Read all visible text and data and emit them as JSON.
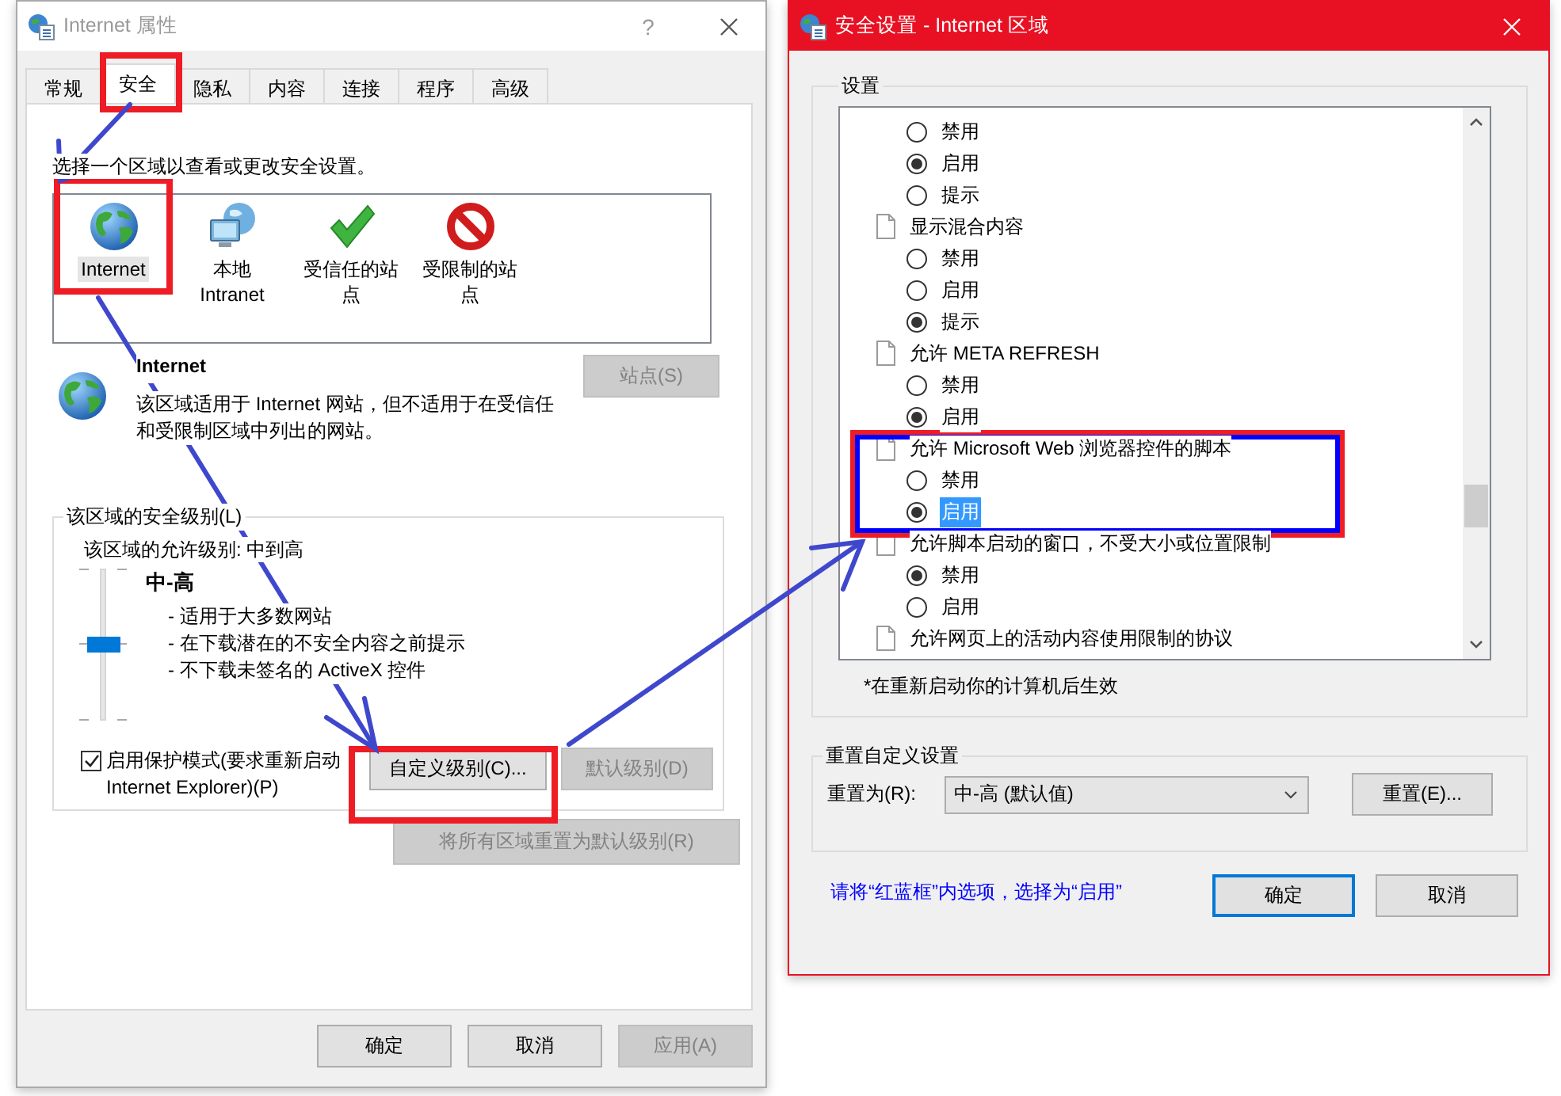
{
  "properties_window": {
    "title": "Internet 属性",
    "active": false,
    "help": "?",
    "tabs": [
      {
        "label": "常规",
        "selected": false
      },
      {
        "label": "安全",
        "selected": true
      },
      {
        "label": "隐私",
        "selected": false
      },
      {
        "label": "内容",
        "selected": false
      },
      {
        "label": "连接",
        "selected": false
      },
      {
        "label": "程序",
        "selected": false
      },
      {
        "label": "高级",
        "selected": false
      }
    ],
    "zone_prompt": "选择一个区域以查看或更改安全设置。",
    "zones": [
      {
        "kind": "globe",
        "label": "Internet",
        "selected": true
      },
      {
        "kind": "intranet",
        "label": "本地 Intranet",
        "selected": false
      },
      {
        "kind": "trusted",
        "label": "受信任的站点",
        "selected": false
      },
      {
        "kind": "restricted",
        "label": "受限制的站点",
        "selected": false
      }
    ],
    "zone_name": "Internet",
    "zone_description": "该区域适用于 Internet 网站，但不适用于在受信任和受限制区域中列出的网站。",
    "sites_button": {
      "label": "站点(S)",
      "disabled": true
    },
    "security_level": {
      "legend": "该区域的安全级别(L)",
      "allowed": "该区域的允许级别: 中到高",
      "level": 0.5,
      "level_name": "中-高",
      "bullets": [
        "- 适用于大多数网站",
        "- 在下载潜在的不安全内容之前提示",
        "- 不下载未签名的 ActiveX 控件"
      ],
      "protected_mode": {
        "label": "启用保护模式(要求重新启动 Internet Explorer)(P)",
        "checked": true
      },
      "custom_button": {
        "label": "自定义级别(C)...",
        "disabled": false
      },
      "default_button": {
        "label": "默认级别(D)",
        "disabled": true
      }
    },
    "reset_all_button": {
      "label": "将所有区域重置为默认级别(R)",
      "disabled": true
    },
    "buttons": [
      {
        "label": "确定",
        "disabled": false
      },
      {
        "label": "取消",
        "disabled": false
      },
      {
        "label": "应用(A)",
        "disabled": true
      }
    ]
  },
  "security_settings_window": {
    "title": "安全设置 - Internet 区域",
    "active": true,
    "settings_legend": "设置",
    "settings": [
      {
        "children": [
          {
            "label": "禁用",
            "selected": false,
            "focused": false
          },
          {
            "label": "启用",
            "selected": true,
            "focused": false
          },
          {
            "label": "提示",
            "selected": false,
            "focused": false
          }
        ]
      },
      {
        "label": "显示混合内容",
        "children": [
          {
            "label": "禁用",
            "selected": false,
            "focused": false
          },
          {
            "label": "启用",
            "selected": false,
            "focused": false
          },
          {
            "label": "提示",
            "selected": true,
            "focused": false
          }
        ]
      },
      {
        "label": "允许 META REFRESH",
        "children": [
          {
            "label": "禁用",
            "selected": false,
            "focused": false
          },
          {
            "label": "启用",
            "selected": true,
            "focused": false
          }
        ]
      },
      {
        "label": "允许 Microsoft Web 浏览器控件的脚本",
        "children": [
          {
            "label": "禁用",
            "selected": false,
            "focused": false
          },
          {
            "label": "启用",
            "selected": true,
            "focused": true
          }
        ]
      },
      {
        "label": "允许脚本启动的窗口，不受大小或位置限制",
        "children": [
          {
            "label": "禁用",
            "selected": true,
            "focused": false
          },
          {
            "label": "启用",
            "selected": false,
            "focused": false
          }
        ]
      },
      {
        "label": "允许网页上的活动内容使用限制的协议"
      }
    ],
    "note": "*在重新启动你的计算机后生效",
    "reset": {
      "legend": "重置自定义设置",
      "label": "重置为(R):",
      "value": "中-高 (默认值)",
      "button": "重置(E)..."
    },
    "instruction": "请将“红蓝框”内选项，选择为“启用”",
    "buttons": [
      {
        "label": "确定",
        "default": true
      },
      {
        "label": "取消",
        "default": false
      }
    ]
  }
}
